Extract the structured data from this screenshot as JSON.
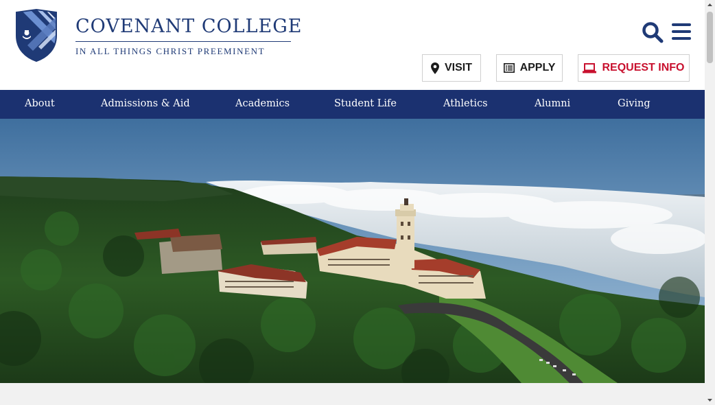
{
  "header": {
    "logo_title": "COVENANT COLLEGE",
    "logo_subtitle": "IN ALL THINGS CHRIST PREEMINENT",
    "search_icon": "search-icon",
    "menu_icon": "hamburger-menu-icon"
  },
  "cta": {
    "visit": "VISIT",
    "visit_icon": "map-pin-icon",
    "apply": "APPLY",
    "apply_icon": "list-icon",
    "request": "REQUEST INFO",
    "request_icon": "laptop-icon"
  },
  "nav": {
    "items": [
      {
        "label": "About"
      },
      {
        "label": "Admissions & Aid"
      },
      {
        "label": "Academics"
      },
      {
        "label": "Student Life"
      },
      {
        "label": "Athletics"
      },
      {
        "label": "Alumni"
      },
      {
        "label": "Giving"
      }
    ]
  },
  "colors": {
    "brand_navy": "#1b3170",
    "accent_red": "#c8102e"
  }
}
